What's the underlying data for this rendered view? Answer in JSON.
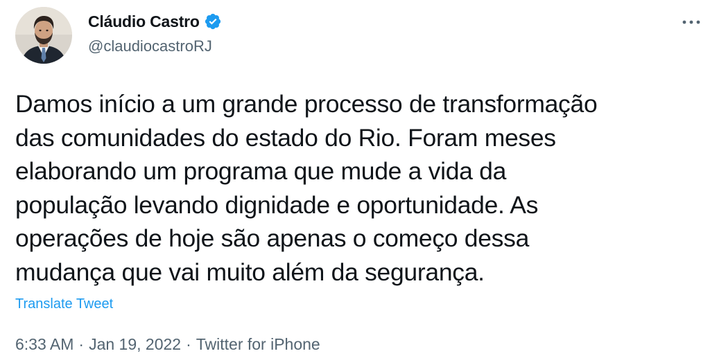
{
  "author": {
    "display_name": "Cláudio Castro",
    "handle": "@claudiocastroRJ",
    "verified": true,
    "avatar_icon": "profile-photo"
  },
  "more_icon": "ellipsis-icon",
  "tweet": {
    "text": "Damos início a um grande processo de transformação\ndas comunidades do estado do Rio. Foram meses\nelaborando um programa que mude a vida da\npopulação levando dignidade e oportunidade. As\noperações de hoje são apenas o começo dessa\nmudança que vai muito além da segurança.",
    "translate_label": "Translate Tweet"
  },
  "meta": {
    "time": "6:33 AM",
    "separator": "·",
    "date": "Jan 19, 2022",
    "source": "Twitter for iPhone"
  },
  "colors": {
    "text": "#0f1419",
    "secondary": "#536471",
    "accent": "#1d9bf0"
  }
}
